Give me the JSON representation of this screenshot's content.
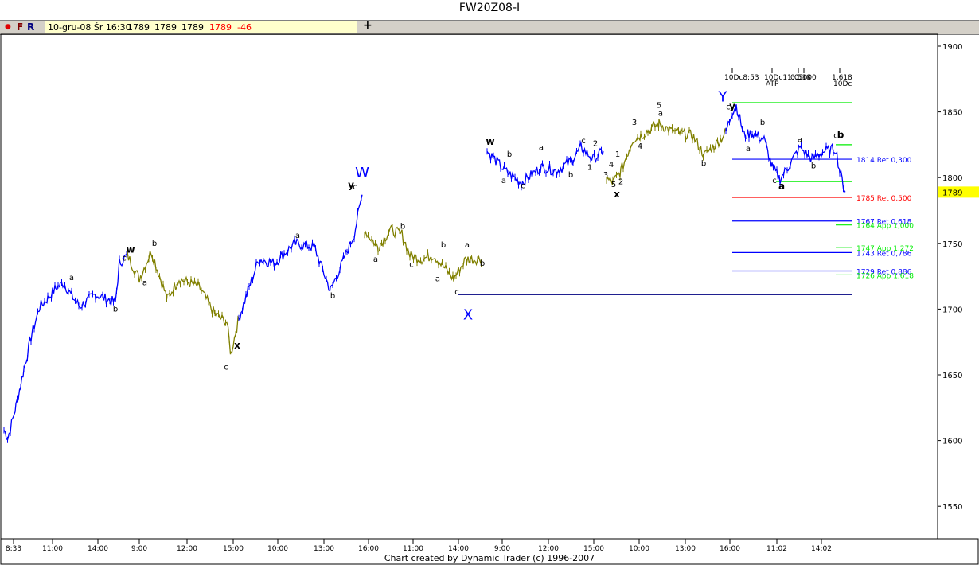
{
  "title": "FW20Z08-I",
  "toolbar": {
    "dot": "●",
    "f": "F",
    "r": "R",
    "date": "10-gru-08 Śr 16:30",
    "open": "1789",
    "high": "1789",
    "low": "1789",
    "close": "1789",
    "change": "-46",
    "plus": "+"
  },
  "caption": "Chart created by Dynamic Trader  (c) 1996-2007",
  "chart_data": {
    "type": "line",
    "title": "FW20Z08-I",
    "ylim": [
      1520,
      1910
    ],
    "yticks": [
      1550,
      1600,
      1650,
      1700,
      1750,
      1800,
      1850,
      1900
    ],
    "last_price": "1789",
    "xticks": [
      [
        17,
        "8:33"
      ],
      [
        66,
        "11:00"
      ],
      [
        123,
        "14:00"
      ],
      [
        175,
        "9:00"
      ],
      [
        235,
        "12:00"
      ],
      [
        293,
        "15:00"
      ],
      [
        349,
        "10:00"
      ],
      [
        407,
        "13:00"
      ],
      [
        463,
        "16:00"
      ],
      [
        519,
        "11:00"
      ],
      [
        576,
        "14:00"
      ],
      [
        631,
        "9:00"
      ],
      [
        689,
        "12:00"
      ],
      [
        746,
        "15:00"
      ],
      [
        803,
        "10:00"
      ],
      [
        861,
        "13:00"
      ],
      [
        917,
        "16:00"
      ],
      [
        976,
        "11:02"
      ],
      [
        1032,
        "14:02"
      ]
    ],
    "segments": [
      {
        "color": "#0000ff",
        "points": [
          [
            5,
            1608
          ],
          [
            10,
            1602
          ],
          [
            20,
            1626
          ],
          [
            30,
            1654
          ],
          [
            40,
            1681
          ],
          [
            50,
            1702
          ],
          [
            60,
            1708
          ],
          [
            70,
            1716
          ],
          [
            80,
            1720
          ],
          [
            90,
            1710
          ],
          [
            100,
            1702
          ],
          [
            120,
            1711
          ],
          [
            145,
            1705
          ],
          [
            150,
            1735
          ],
          [
            160,
            1741
          ]
        ]
      },
      {
        "color": "#808000",
        "points": [
          [
            160,
            1741
          ],
          [
            175,
            1723
          ],
          [
            190,
            1744
          ],
          [
            210,
            1708
          ],
          [
            225,
            1723
          ],
          [
            250,
            1717
          ],
          [
            270,
            1696
          ],
          [
            285,
            1690
          ],
          [
            290,
            1666
          ],
          [
            300,
            1693
          ]
        ]
      },
      {
        "color": "#0000ff",
        "points": [
          [
            300,
            1693
          ],
          [
            310,
            1711
          ],
          [
            325,
            1738
          ],
          [
            345,
            1735
          ],
          [
            370,
            1750
          ],
          [
            395,
            1747
          ],
          [
            415,
            1714
          ],
          [
            430,
            1735
          ],
          [
            445,
            1757
          ],
          [
            455,
            1787
          ]
        ]
      },
      {
        "color": "#808000",
        "points": [
          [
            458,
            1760
          ],
          [
            475,
            1747
          ],
          [
            490,
            1760
          ],
          [
            505,
            1757
          ],
          [
            515,
            1741
          ],
          [
            530,
            1738
          ],
          [
            545,
            1741
          ],
          [
            570,
            1723
          ],
          [
            585,
            1738
          ],
          [
            605,
            1738
          ]
        ]
      },
      {
        "color": "#0000ff",
        "points": [
          [
            612,
            1820
          ],
          [
            620,
            1815
          ],
          [
            635,
            1805
          ],
          [
            655,
            1796
          ],
          [
            680,
            1808
          ],
          [
            700,
            1805
          ],
          [
            720,
            1814
          ],
          [
            730,
            1823
          ],
          [
            745,
            1814
          ],
          [
            758,
            1820
          ]
        ]
      },
      {
        "color": "#808000",
        "points": [
          [
            762,
            1799
          ],
          [
            770,
            1796
          ],
          [
            780,
            1805
          ],
          [
            795,
            1829
          ],
          [
            805,
            1832
          ],
          [
            828,
            1841
          ],
          [
            845,
            1835
          ],
          [
            870,
            1832
          ],
          [
            885,
            1817
          ],
          [
            905,
            1829
          ],
          [
            912,
            1835
          ]
        ]
      },
      {
        "color": "#0000ff",
        "points": [
          [
            912,
            1835
          ],
          [
            920,
            1850
          ],
          [
            925,
            1855
          ],
          [
            935,
            1832
          ],
          [
            945,
            1834
          ],
          [
            960,
            1829
          ],
          [
            970,
            1808
          ],
          [
            980,
            1799
          ],
          [
            990,
            1808
          ],
          [
            1005,
            1823
          ],
          [
            1020,
            1814
          ],
          [
            1035,
            1820
          ],
          [
            1050,
            1822
          ],
          [
            1055,
            1805
          ],
          [
            1062,
            1789
          ]
        ]
      }
    ],
    "levels": [
      {
        "label": "1814 Ret 0,300",
        "value": 1814,
        "color": "#0000ff",
        "from": 920
      },
      {
        "label": "1785 Ret 0,500",
        "value": 1785,
        "color": "#ff0000",
        "from": 920
      },
      {
        "label": "1767 Ret 0,618",
        "value": 1767,
        "color": "#0000ff",
        "from": 920
      },
      {
        "label": "1764 App 1,000",
        "value": 1764,
        "color": "#00ee00",
        "from": 1050
      },
      {
        "label": "1747 App 1,272",
        "value": 1747,
        "color": "#00ee00",
        "from": 1050
      },
      {
        "label": "1743 Ret 0,786",
        "value": 1743,
        "color": "#0000ff",
        "from": 920
      },
      {
        "label": "1729 Ret 0,886",
        "value": 1729,
        "color": "#0000ff",
        "from": 920
      },
      {
        "label": "1726 App 1,618",
        "value": 1726,
        "color": "#00ee00",
        "from": 1050
      },
      {
        "label": "",
        "value": 1857,
        "color": "#00ee00",
        "from": 920
      },
      {
        "label": "",
        "value": 1825,
        "color": "#00ee00",
        "from": 1050
      },
      {
        "label": "",
        "value": 1797,
        "color": "#00ee00",
        "from": 975
      },
      {
        "label": "",
        "value": 1711,
        "color": "#000080",
        "from": 575
      }
    ],
    "time_markers": [
      [
        920,
        "10Dc8:53",
        ""
      ],
      [
        970,
        "10Dc11:05",
        "ATP"
      ],
      [
        1003,
        "0,518",
        ""
      ],
      [
        1010,
        "1,000",
        ""
      ],
      [
        1055,
        "1,618",
        "10Dc"
      ]
    ],
    "wave_labels": [
      [
        "W",
        455,
        1800,
        "#0000ff",
        18
      ],
      [
        "X",
        588,
        1692,
        "#0000ff",
        18
      ],
      [
        "Y",
        908,
        1858,
        "#0000ff",
        18
      ],
      [
        "w",
        164,
        1743,
        "#000",
        12
      ],
      [
        "x",
        298,
        1670,
        "#000",
        12
      ],
      [
        "y",
        441,
        1792,
        "#000",
        12
      ],
      [
        "w",
        616,
        1825,
        "#000",
        12
      ],
      [
        "x",
        775,
        1785,
        "#000",
        12
      ],
      [
        "y",
        920,
        1852,
        "#000",
        12
      ],
      [
        "a",
        982,
        1791,
        "#000",
        12
      ],
      [
        "b",
        1056,
        1830,
        "#000",
        12
      ],
      [
        "c",
        156,
        1737,
        "#000",
        10
      ],
      [
        "b",
        194,
        1748,
        "#000",
        10
      ],
      [
        "a",
        182,
        1718,
        "#000",
        10
      ],
      [
        "a",
        90,
        1722,
        "#000",
        10
      ],
      [
        "b",
        145,
        1698,
        "#000",
        10
      ],
      [
        "c",
        284,
        1654,
        "#000",
        10
      ],
      [
        "a",
        374,
        1754,
        "#000",
        10
      ],
      [
        "b",
        418,
        1708,
        "#000",
        10
      ],
      [
        "c",
        446,
        1791,
        "#000",
        10
      ],
      [
        "a",
        472,
        1736,
        "#000",
        10
      ],
      [
        "b",
        506,
        1761,
        "#000",
        10
      ],
      [
        "c",
        517,
        1732,
        "#000",
        10
      ],
      [
        "a",
        550,
        1721,
        "#000",
        10
      ],
      [
        "b",
        557,
        1747,
        "#000",
        10
      ],
      [
        "c",
        574,
        1711,
        "#000",
        10
      ],
      [
        "a",
        587,
        1747,
        "#000",
        10
      ],
      [
        "b",
        606,
        1733,
        "#000",
        10
      ],
      [
        "b",
        640,
        1816,
        "#000",
        10
      ],
      [
        "a",
        633,
        1796,
        "#000",
        10
      ],
      [
        "c",
        657,
        1792,
        "#000",
        10
      ],
      [
        "a",
        680,
        1821,
        "#000",
        10
      ],
      [
        "b",
        717,
        1800,
        "#000",
        10
      ],
      [
        "c",
        733,
        1826,
        "#000",
        10
      ],
      [
        "2",
        748,
        1824,
        "#000",
        10
      ],
      [
        "1",
        741,
        1806,
        "#000",
        10
      ],
      [
        "4",
        768,
        1808,
        "#000",
        10
      ],
      [
        "3",
        761,
        1800,
        "#000",
        10
      ],
      [
        "5",
        771,
        1793,
        "#000",
        10
      ],
      [
        "2",
        780,
        1795,
        "#000",
        10
      ],
      [
        "1",
        776,
        1816,
        "#000",
        10
      ],
      [
        "3",
        797,
        1840,
        "#000",
        10
      ],
      [
        "4",
        804,
        1822,
        "#000",
        10
      ],
      [
        "5",
        828,
        1853,
        "#000",
        10
      ],
      [
        "a",
        830,
        1847,
        "#000",
        10
      ],
      [
        "b",
        884,
        1809,
        "#000",
        10
      ],
      [
        "c",
        915,
        1852,
        "#000",
        10
      ],
      [
        "a",
        940,
        1820,
        "#000",
        10
      ],
      [
        "b",
        958,
        1840,
        "#000",
        10
      ],
      [
        "a",
        1005,
        1827,
        "#000",
        10
      ],
      [
        "b",
        1022,
        1807,
        "#000",
        10
      ],
      [
        "c",
        973,
        1796,
        "#000",
        10
      ],
      [
        "c",
        1050,
        1830,
        "#000",
        10
      ]
    ]
  }
}
